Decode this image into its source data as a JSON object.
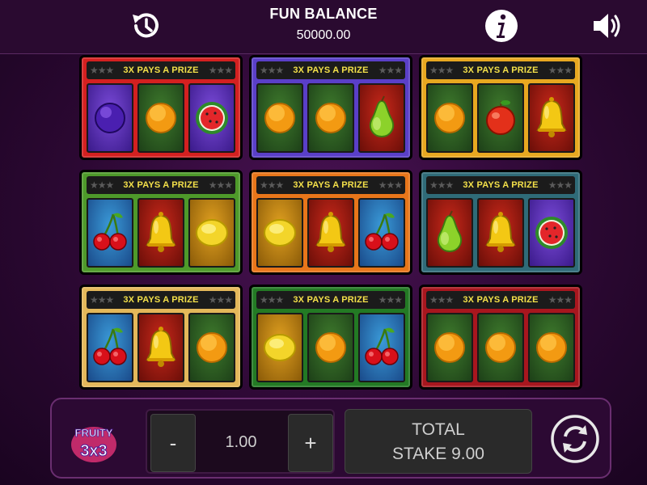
{
  "header": {
    "balance_title": "FUN BALANCE",
    "balance_value": "50000.00",
    "history_icon": "history-icon",
    "info_icon": "info-icon",
    "sound_icon": "speaker-icon"
  },
  "colors": {
    "card_red": "#d42020",
    "card_blue": "#5a3fc8",
    "card_yellow": "#e8a820",
    "card_green": "#4e9a2a",
    "card_orange": "#e8761a",
    "card_teal": "#2f6b78",
    "card_cream": "#e4b85a",
    "card_dkgreen": "#237a24",
    "card_dkred": "#a8161e",
    "prize_text": "#f3e04a"
  },
  "cards": [
    {
      "header": "3X PAYS A PRIZE",
      "color": "#d42020",
      "symbols": [
        "plum",
        "orange",
        "watermelon"
      ]
    },
    {
      "header": "3X PAYS A PRIZE",
      "color": "#5a3fc8",
      "symbols": [
        "orange",
        "orange",
        "pear"
      ]
    },
    {
      "header": "3X PAYS A PRIZE",
      "color": "#e8a820",
      "symbols": [
        "orange",
        "apple",
        "bell"
      ]
    },
    {
      "header": "3X PAYS A PRIZE",
      "color": "#4e9a2a",
      "symbols": [
        "cherry",
        "bell",
        "lemon"
      ]
    },
    {
      "header": "3X PAYS A PRIZE",
      "color": "#e8761a",
      "symbols": [
        "lemon",
        "bell",
        "cherry"
      ]
    },
    {
      "header": "3X PAYS A PRIZE",
      "color": "#2f6b78",
      "symbols": [
        "pear",
        "bell",
        "watermelon"
      ]
    },
    {
      "header": "3X PAYS A PRIZE",
      "color": "#e4b85a",
      "symbols": [
        "cherry",
        "bell",
        "orange"
      ]
    },
    {
      "header": "3X PAYS A PRIZE",
      "color": "#237a24",
      "symbols": [
        "lemon",
        "orange",
        "cherry"
      ]
    },
    {
      "header": "3X PAYS A PRIZE",
      "color": "#a8161e",
      "symbols": [
        "orange",
        "orange",
        "orange"
      ]
    }
  ],
  "controls": {
    "logo_text_1": "FRUITY",
    "logo_text_2": "3x3",
    "minus_label": "-",
    "plus_label": "+",
    "stake_value": "1.00",
    "total_label": "TOTAL",
    "total_stake_line": "STAKE 9.00",
    "spin_icon": "refresh-icon"
  }
}
